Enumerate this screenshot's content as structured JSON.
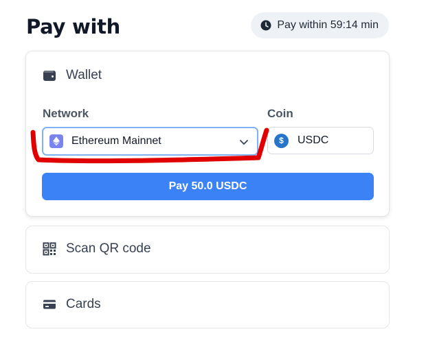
{
  "header": {
    "title": "Pay with",
    "timer_label": "Pay within 59:14 min",
    "timer_icon": "clock-icon"
  },
  "wallet": {
    "label": "Wallet",
    "icon": "wallet-icon",
    "network_label": "Network",
    "network_value": "Ethereum Mainnet",
    "network_icon": "ethereum-icon",
    "coin_label": "Coin",
    "coin_value": "USDC",
    "coin_icon": "usdc-icon",
    "pay_button": "Pay 50.0 USDC"
  },
  "qr": {
    "label": "Scan QR code",
    "icon": "qr-code-icon"
  },
  "cards": {
    "label": "Cards",
    "icon": "credit-card-icon"
  },
  "colors": {
    "accent": "#3b82f6",
    "select_border": "#7fb2f2",
    "annotation_red": "#e00000",
    "eth": "#7b84ee",
    "usdc": "#2775ca"
  }
}
